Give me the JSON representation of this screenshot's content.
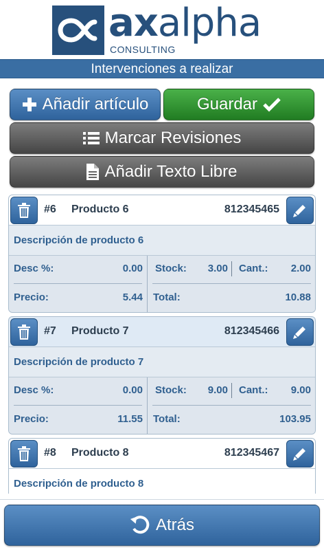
{
  "brand": {
    "name_bold": "ax",
    "name_light": "alpha",
    "subtitle": "CONSULTING",
    "primary_color": "#27507c"
  },
  "title_bar": {
    "text": "Intervenciones a realizar"
  },
  "buttons": {
    "add_article": {
      "label": "Añadir artículo",
      "icon": "plus-icon"
    },
    "save": {
      "label": "Guardar",
      "icon": "check-icon"
    },
    "mark_reviews": {
      "label": "Marcar Revisiones",
      "icon": "list-icon"
    },
    "add_free_text": {
      "label": "Añadir Texto Libre",
      "icon": "document-icon"
    },
    "back": {
      "label": "Atrás",
      "icon": "undo-icon"
    }
  },
  "labels": {
    "desc_pct": "Desc %:",
    "stock": "Stock:",
    "qty": "Cant.:",
    "price": "Precio:",
    "total": "Total:"
  },
  "items": [
    {
      "num": "#6",
      "name": "Producto 6",
      "code": "812345465",
      "description": "Descripción de producto 6",
      "desc_pct": "0.00",
      "stock": "3.00",
      "qty": "2.00",
      "price": "5.44",
      "total": "10.88"
    },
    {
      "num": "#7",
      "name": "Producto 7",
      "code": "812345466",
      "description": "Descripción de producto 7",
      "desc_pct": "0.00",
      "stock": "9.00",
      "qty": "9.00",
      "price": "11.55",
      "total": "103.95"
    },
    {
      "num": "#8",
      "name": "Producto 8",
      "code": "812345467",
      "description": "Descripción de producto 8"
    }
  ],
  "colors": {
    "blue_button": "#3a6ea3",
    "green_button": "#2e8f2f",
    "grey_button": "#5a5a5a",
    "label_text": "#2f5f8f"
  }
}
